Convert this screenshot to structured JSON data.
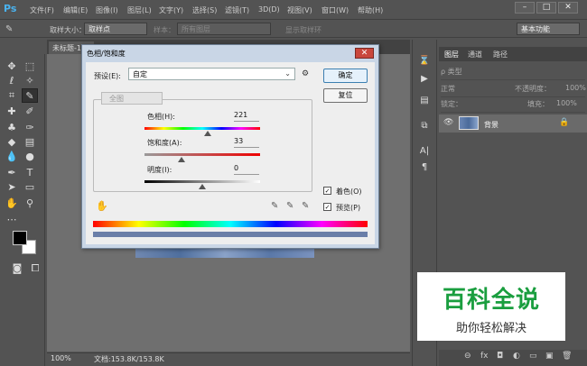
{
  "app": {
    "logo": "Ps"
  },
  "menu": [
    "文件(F)",
    "编辑(E)",
    "图像(I)",
    "图层(L)",
    "文字(Y)",
    "选择(S)",
    "滤镜(T)",
    "3D(D)",
    "视图(V)",
    "窗口(W)",
    "帮助(H)"
  ],
  "window_buttons": {
    "minimize": "–",
    "restore": "□",
    "close": "✕"
  },
  "options_bar": {
    "sample_size_label": "取样大小：",
    "sample_size_value": "取样点",
    "sample_label": "样本：",
    "sample_value": "所有图层",
    "show_ring": "显示取样环",
    "workspace": "基本功能"
  },
  "document": {
    "tab_title": "未标题-1",
    "zoom": "100%",
    "info": "文档:153.8K/153.8K"
  },
  "layers_panel": {
    "tabs": [
      "图层",
      "通道",
      "路径"
    ],
    "kind_filter": "ρ 类型",
    "blend_mode": "正常",
    "opacity_label": "不透明度：",
    "opacity_value": "100%",
    "lock_label": "锁定：",
    "fill_label": "填充：",
    "fill_value": "100%",
    "layer_name": "背景",
    "bottom_icons": [
      "⊖",
      "fx",
      "◘",
      "◐",
      "▭",
      "▣",
      "🗑"
    ]
  },
  "dialog": {
    "title": "色相/饱和度",
    "close": "✕",
    "preset_label": "预设(E):",
    "preset_value": "自定",
    "ok_button": "确定",
    "reset_button": "复位",
    "channel": "全图",
    "hue_label": "色相(H):",
    "hue_value": "221",
    "hue_level": 0.55,
    "saturation_label": "饱和度(A):",
    "saturation_value": "33",
    "saturation_level": 0.32,
    "lightness_label": "明度(I):",
    "lightness_value": "0",
    "lightness_level": 0.5,
    "colorize_label": "着色(O)",
    "colorize_checked": true,
    "preview_label": "预览(P)",
    "preview_checked": true
  },
  "watermark": {
    "main": "百科全说",
    "sub": "助你轻松解决"
  },
  "colors": {
    "accent": "#1a9e3f",
    "ps_blue": "#4ab3f0"
  }
}
